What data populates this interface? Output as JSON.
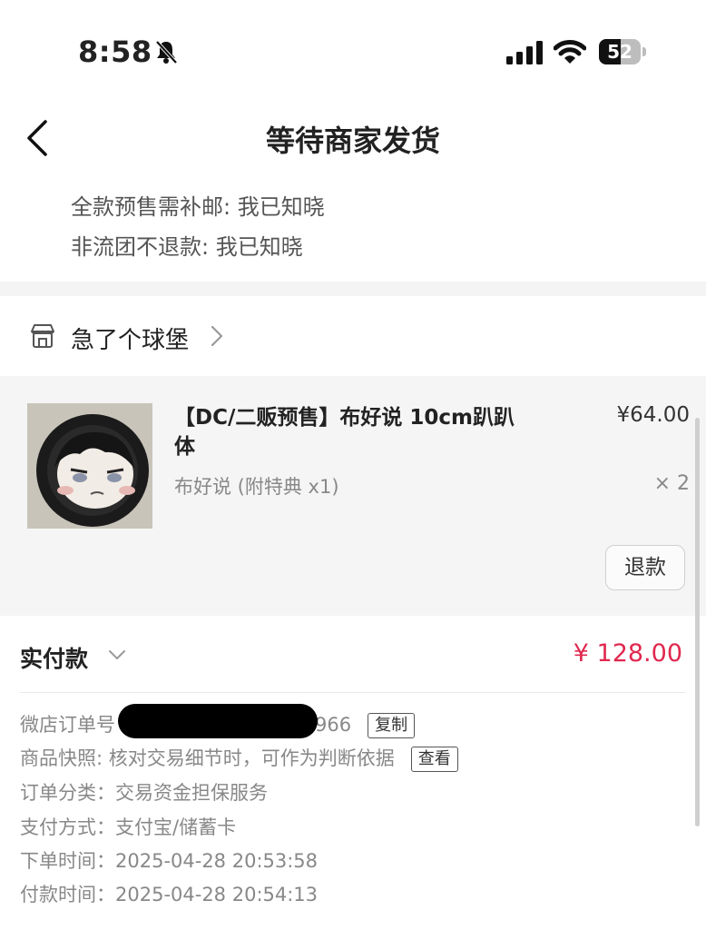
{
  "status_bar": {
    "time": "8:58",
    "battery": "52",
    "battery_level": 0.52
  },
  "header": {
    "title": "等待商家发货"
  },
  "notes": [
    "全款预售需补邮: 我已知晓",
    "非流团不退款: 我已知晓"
  ],
  "store": {
    "name": "急了个球堡"
  },
  "product": {
    "title": "【DC/二贩预售】布好说 10cm趴趴体",
    "price": "¥64.00",
    "variant": "布好说 (附特典 x1)",
    "quantity": "× 2",
    "refund_label": "退款"
  },
  "payment": {
    "paid_label": "实付款",
    "paid_amount": "¥ 128.00",
    "order_number": {
      "key": "微店订单号",
      "value_visible": "966",
      "copy_label": "复制"
    },
    "snapshot": {
      "key": "商品快照: ",
      "value": "核对交易细节时，可作为判断依据",
      "view_label": "查看"
    },
    "category": {
      "key": "订单分类：",
      "value": "交易资金担保服务"
    },
    "pay_method": {
      "key": "支付方式：",
      "value": "支付宝/储蓄卡"
    },
    "order_time": {
      "key": "下单时间：",
      "value": "2025-04-28 20:53:58"
    },
    "pay_time": {
      "key": "付款时间：",
      "value": "2025-04-28 20:54:13"
    }
  },
  "colors": {
    "accent": "#e0284f"
  }
}
